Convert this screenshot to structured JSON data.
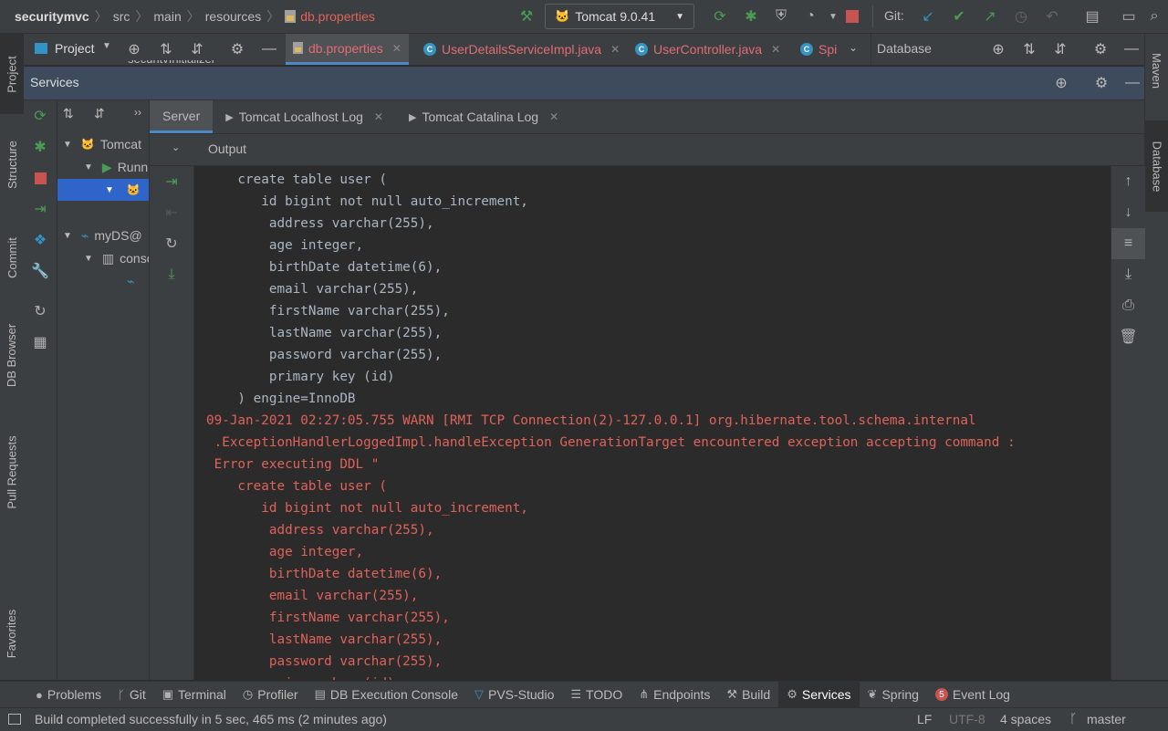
{
  "colors": {
    "accent_selected": "#2f65ca",
    "error_text": "#e0625a",
    "normal_text": "#a9b7c6",
    "run_green": "#499c54",
    "stop_red": "#c75450",
    "git_blue": "#3592c4"
  },
  "navbar": {
    "breadcrumb": [
      "securitymvc",
      "src",
      "main",
      "resources",
      "db.properties"
    ],
    "run_config": "Tomcat 9.0.41",
    "git_label": "Git:"
  },
  "left_strip": [
    "Project",
    "Structure",
    "Commit",
    "DB Browser",
    "Pull Requests",
    "Favorites"
  ],
  "right_strip": [
    "Maven",
    "Database"
  ],
  "editor_tabs": {
    "project_label": "Project",
    "tabs": [
      {
        "label": "db.properties",
        "icon": "properties-icon"
      },
      {
        "label": "UserDetailsServiceImpl.java",
        "icon": "class-icon"
      },
      {
        "label": "UserController.java",
        "icon": "class-icon"
      },
      {
        "label": "Spi",
        "icon": "class-icon"
      }
    ],
    "database_label": "Database",
    "hidden_tree_text": "securitvInitializer"
  },
  "services": {
    "title": "Services",
    "tree": [
      {
        "label": "Tomcat",
        "icon": "tomcat-icon"
      },
      {
        "label": "Running",
        "icon": "run-icon"
      },
      {
        "label": "",
        "icon": "tomcat-app-icon"
      },
      {
        "label": "myDS@",
        "icon": "mysql-icon"
      },
      {
        "label": "console",
        "icon": "console-icon"
      },
      {
        "label": "",
        "icon": "mysql-session-icon"
      }
    ],
    "tabs": [
      "Server",
      "Tomcat Localhost Log",
      "Tomcat Catalina Log"
    ],
    "output_label": "Output"
  },
  "console": {
    "lines": [
      {
        "text": "    create table user (",
        "error": false
      },
      {
        "text": "       id bigint not null auto_increment,",
        "error": false
      },
      {
        "text": "        address varchar(255),",
        "error": false
      },
      {
        "text": "        age integer,",
        "error": false
      },
      {
        "text": "        birthDate datetime(6),",
        "error": false
      },
      {
        "text": "        email varchar(255),",
        "error": false
      },
      {
        "text": "        firstName varchar(255),",
        "error": false
      },
      {
        "text": "        lastName varchar(255),",
        "error": false
      },
      {
        "text": "        password varchar(255),",
        "error": false
      },
      {
        "text": "        primary key (id)",
        "error": false
      },
      {
        "text": "    ) engine=InnoDB",
        "error": false
      },
      {
        "text": "09-Jan-2021 02:27:05.755 WARN [RMI TCP Connection(2)-127.0.0.1] org.hibernate.tool.schema.internal",
        "error": true
      },
      {
        "text": " .ExceptionHandlerLoggedImpl.handleException GenerationTarget encountered exception accepting command :",
        "error": true
      },
      {
        "text": " Error executing DDL \"",
        "error": true
      },
      {
        "text": "    create table user (",
        "error": true
      },
      {
        "text": "       id bigint not null auto_increment,",
        "error": true
      },
      {
        "text": "        address varchar(255),",
        "error": true
      },
      {
        "text": "        age integer,",
        "error": true
      },
      {
        "text": "        birthDate datetime(6),",
        "error": true
      },
      {
        "text": "        email varchar(255),",
        "error": true
      },
      {
        "text": "        firstName varchar(255),",
        "error": true
      },
      {
        "text": "        lastName varchar(255),",
        "error": true
      },
      {
        "text": "        password varchar(255),",
        "error": true
      },
      {
        "text": "        primary key (id)",
        "error": true
      }
    ]
  },
  "bottom_tabs": [
    {
      "label": "Problems",
      "icon": "problems-icon"
    },
    {
      "label": "Git",
      "icon": "git-branch-icon"
    },
    {
      "label": "Terminal",
      "icon": "terminal-icon"
    },
    {
      "label": "Profiler",
      "icon": "profiler-icon"
    },
    {
      "label": "DB Execution Console",
      "icon": "db-console-icon"
    },
    {
      "label": "PVS-Studio",
      "icon": "pvs-icon"
    },
    {
      "label": "TODO",
      "icon": "todo-icon"
    },
    {
      "label": "Endpoints",
      "icon": "endpoints-icon"
    },
    {
      "label": "Build",
      "icon": "hammer-icon"
    },
    {
      "label": "Services",
      "icon": "services-icon",
      "active": true
    },
    {
      "label": "Spring",
      "icon": "spring-icon"
    },
    {
      "label": "Event Log",
      "icon": "event-log-icon",
      "badge": "5"
    }
  ],
  "statusbar": {
    "message": "Build completed successfully in 5 sec, 465 ms (2 minutes ago)",
    "line_sep": "LF",
    "encoding": "UTF-8",
    "indent": "4 spaces",
    "branch": "master"
  }
}
